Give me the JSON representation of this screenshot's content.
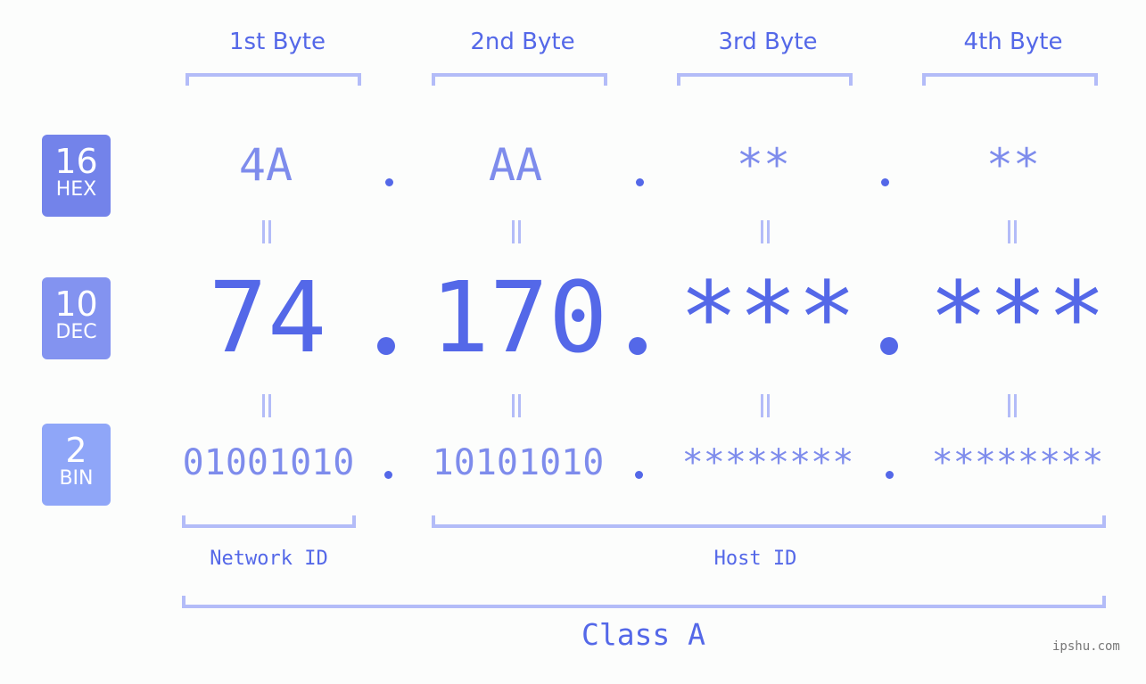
{
  "ip": {
    "hex": [
      "4A",
      "AA",
      "**",
      "**"
    ],
    "dec": [
      "74",
      "170",
      "***",
      "***"
    ],
    "bin": [
      "01001010",
      "10101010",
      "********",
      "********"
    ],
    "separator": "."
  },
  "byte_headers": [
    "1st Byte",
    "2nd Byte",
    "3rd Byte",
    "4th Byte"
  ],
  "badges": {
    "hex": {
      "base": "16",
      "label": "HEX",
      "color": "#7383ea"
    },
    "dec": {
      "base": "10",
      "label": "DEC",
      "color": "#8393f0"
    },
    "bin": {
      "base": "2",
      "label": "BIN",
      "color": "#8fa6f8"
    }
  },
  "segments": {
    "network_id": "Network ID",
    "host_id": "Host ID"
  },
  "ip_class": "Class A",
  "watermark": "ipshu.com",
  "colors": {
    "primary": "#5468e8",
    "secondary": "#7e8cec",
    "bracket": "#b3bcf8"
  }
}
